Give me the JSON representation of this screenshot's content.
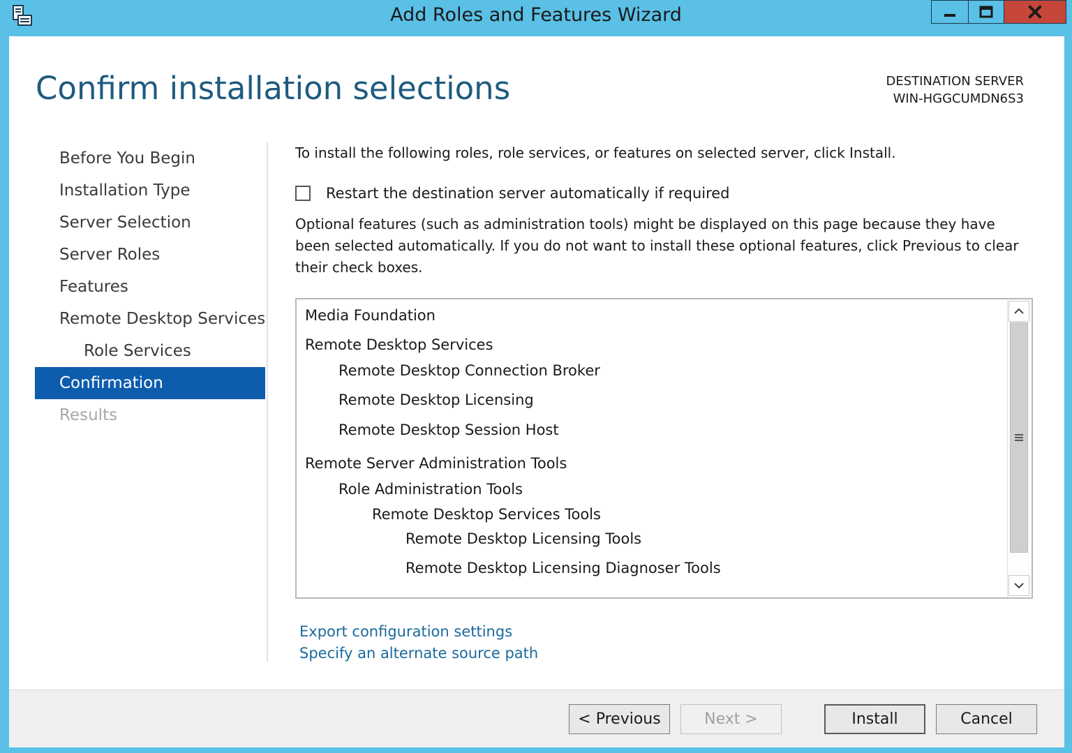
{
  "window": {
    "title": "Add Roles and Features Wizard",
    "controls": {
      "minimize": "minimize",
      "maximize": "maximize",
      "close": "close"
    },
    "accent_color": "#5ac0e6",
    "close_color": "#c7463a"
  },
  "header": {
    "page_title": "Confirm installation selections",
    "destination_label": "DESTINATION SERVER",
    "destination_server": "WIN-HGGCUMDN6S3"
  },
  "nav": {
    "items": [
      {
        "label": "Before You Begin",
        "state": "normal"
      },
      {
        "label": "Installation Type",
        "state": "normal"
      },
      {
        "label": "Server Selection",
        "state": "normal"
      },
      {
        "label": "Server Roles",
        "state": "normal"
      },
      {
        "label": "Features",
        "state": "normal"
      },
      {
        "label": "Remote Desktop Services",
        "state": "normal"
      },
      {
        "label": "Role Services",
        "state": "sub"
      },
      {
        "label": "Confirmation",
        "state": "active"
      },
      {
        "label": "Results",
        "state": "disabled"
      }
    ],
    "active_color": "#0d5cae"
  },
  "content": {
    "intro": "To install the following roles, role services, or features on selected server, click Install.",
    "restart_label": "Restart the destination server automatically if required",
    "restart_checked": false,
    "optional_note": "Optional features (such as administration tools) might be displayed on this page because they have been selected automatically. If you do not want to install these optional features, click Previous to clear their check boxes."
  },
  "selections": [
    {
      "label": "Media Foundation",
      "level": 0
    },
    {
      "label": "Remote Desktop Services",
      "level": 0
    },
    {
      "label": "Remote Desktop Connection Broker",
      "level": 1
    },
    {
      "label": "Remote Desktop Licensing",
      "level": 1
    },
    {
      "label": "Remote Desktop Session Host",
      "level": 1
    },
    {
      "label": "Remote Server Administration Tools",
      "level": 0
    },
    {
      "label": "Role Administration Tools",
      "level": 1
    },
    {
      "label": "Remote Desktop Services Tools",
      "level": 2
    },
    {
      "label": "Remote Desktop Licensing Tools",
      "level": 3
    },
    {
      "label": "Remote Desktop Licensing Diagnoser Tools",
      "level": 3
    }
  ],
  "links": {
    "export": "Export configuration settings",
    "alternate_source": "Specify an alternate source path"
  },
  "footer": {
    "previous": "< Previous",
    "next": "Next >",
    "install": "Install",
    "cancel": "Cancel"
  }
}
